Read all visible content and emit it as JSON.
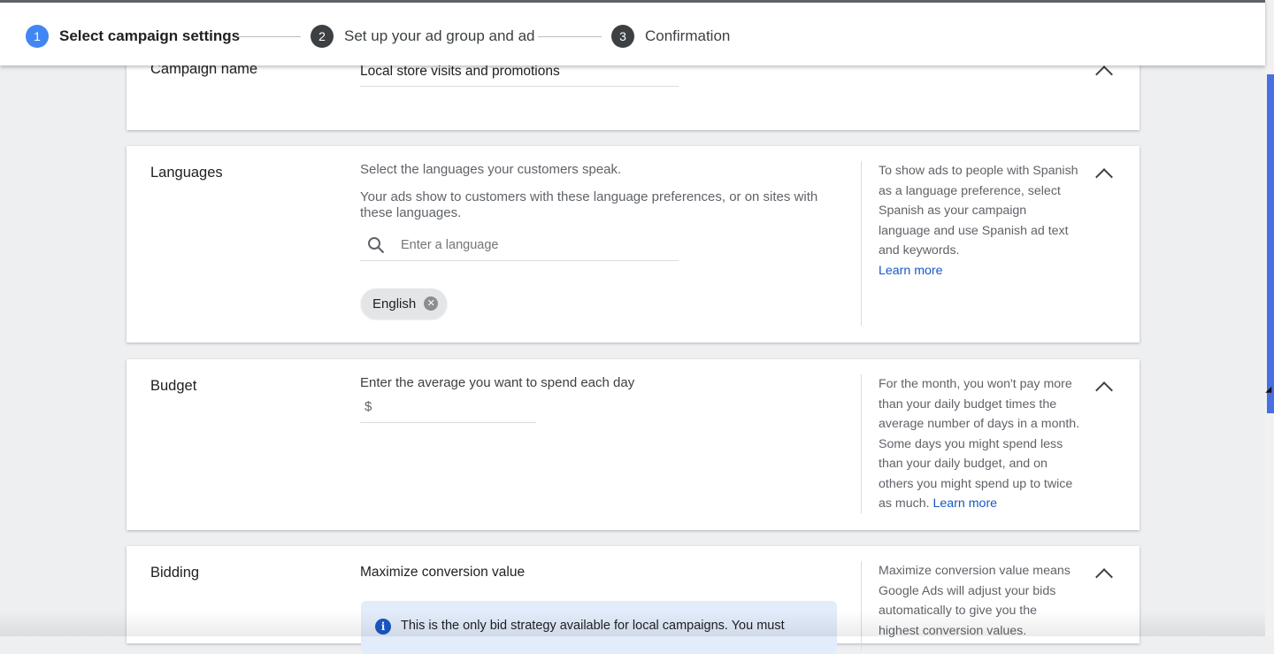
{
  "stepper": {
    "steps": [
      {
        "num": "1",
        "label": "Select campaign settings"
      },
      {
        "num": "2",
        "label": "Set up your ad group and ad"
      },
      {
        "num": "3",
        "label": "Confirmation"
      }
    ]
  },
  "campaign_name": {
    "title": "Campaign name",
    "value": "Local store visits and promotions"
  },
  "languages": {
    "title": "Languages",
    "prompt": "Select the languages your customers speak.",
    "description_line1": "Your ads show to customers with these language preferences, or on sites with",
    "description_line2": "these languages.",
    "search_placeholder": "Enter a language",
    "chips": [
      "English"
    ],
    "help_text": "To show ads to people with Spanish as a language preference, select Spanish as your campaign language and use Spanish ad text and keywords.",
    "help_link": "Learn more"
  },
  "budget": {
    "title": "Budget",
    "prompt": "Enter the average you want to spend each day",
    "currency": "$",
    "value": "",
    "help_text": "For the month, you won't pay more than your daily budget times the average number of days in a month. Some days you might spend less than your daily budget, and on others you might spend up to twice as much.",
    "help_link": "Learn more"
  },
  "bidding": {
    "title": "Bidding",
    "strategy": "Maximize conversion value",
    "info_text": "This is the only bid strategy available for local campaigns. You must",
    "help_text": "Maximize conversion value means Google Ads will adjust your bids automatically to give you the highest conversion values."
  },
  "colors": {
    "accent": "#4285f4",
    "link": "#1a57c5",
    "scrollbar": "#4a6fe3"
  }
}
